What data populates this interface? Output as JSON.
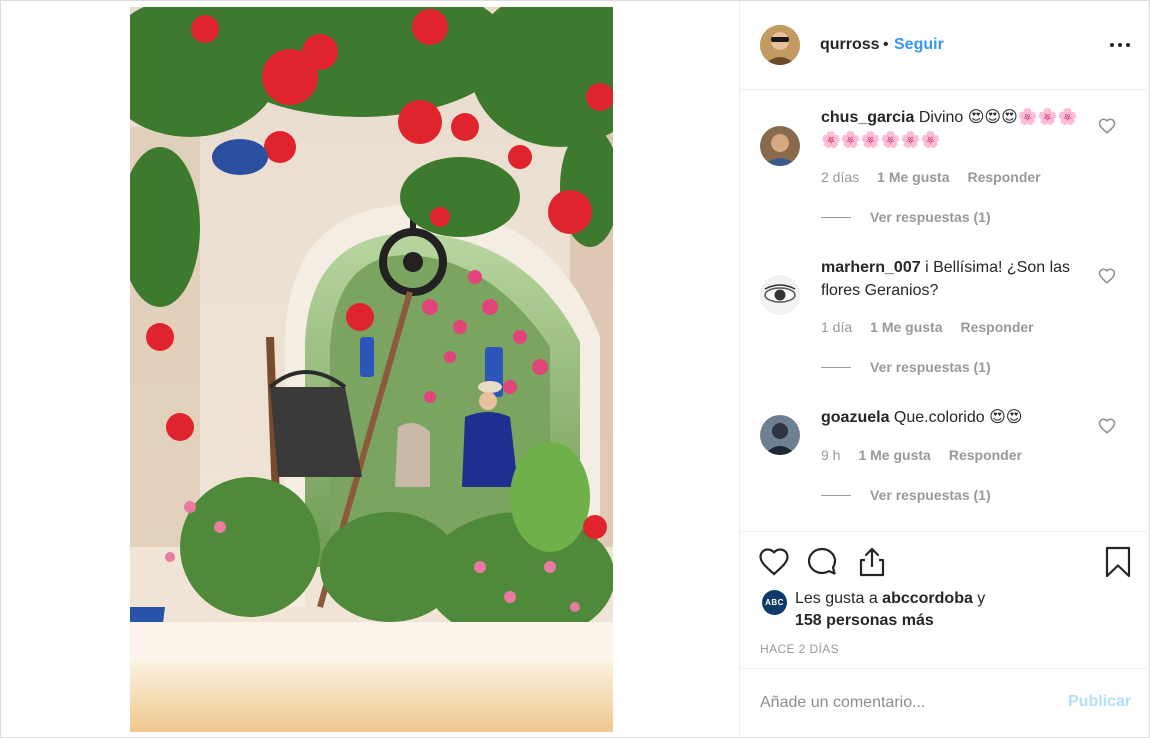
{
  "post": {
    "username": "qurross",
    "separator": "•",
    "follow_label": "Seguir",
    "more_icon": "more-horizontal-icon"
  },
  "comments": [
    {
      "username": "chus_garcia",
      "text": "Divino 😍😍😍🌸🌸🌸🌸🌸🌸🌸🌸🌸",
      "time": "2 días",
      "likes": "1 Me gusta",
      "reply_label": "Responder",
      "view_replies": "Ver respuestas (1)"
    },
    {
      "username": "marhern_007",
      "text": "i Bellísima! ¿Son las flores Geranios?",
      "time": "1 día",
      "likes": "1 Me gusta",
      "reply_label": "Responder",
      "view_replies": "Ver respuestas (1)"
    },
    {
      "username": "goazuela",
      "text": "Que.colorido 😍😍",
      "time": "9 h",
      "likes": "1 Me gusta",
      "reply_label": "Responder",
      "view_replies": "Ver respuestas (1)"
    }
  ],
  "likes": {
    "avatar_text": "ABC",
    "prefix": "Les gusta a ",
    "user": "abccordoba",
    "suffix": " y",
    "count": "158 personas más"
  },
  "timestamp": "HACE 2 DÍAS",
  "add_comment": {
    "placeholder": "Añade un comentario...",
    "publish_label": "Publicar"
  },
  "colors": {
    "link": "#3897f0",
    "muted": "#999999",
    "publish_disabled": "#b2dffc"
  }
}
